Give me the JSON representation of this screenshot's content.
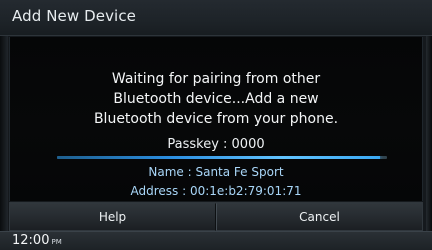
{
  "window": {
    "title": "Add New Device"
  },
  "dialog": {
    "message_lines": [
      "Waiting for pairing from other",
      "Bluetooth device...Add a new",
      "Bluetooth device from your phone."
    ],
    "passkey": "Passkey : 0000",
    "device_name": "Name : Santa Fe Sport",
    "device_address": "Address : 00:1e:b2:79:01:71",
    "progress_fraction": 0.98
  },
  "buttons": {
    "help_label": "Help",
    "cancel_label": "Cancel"
  },
  "status": {
    "time": "12:00",
    "ampm": "PM"
  },
  "colors": {
    "accent": "#2fa6ff",
    "detail_text": "#a9d6f8"
  }
}
